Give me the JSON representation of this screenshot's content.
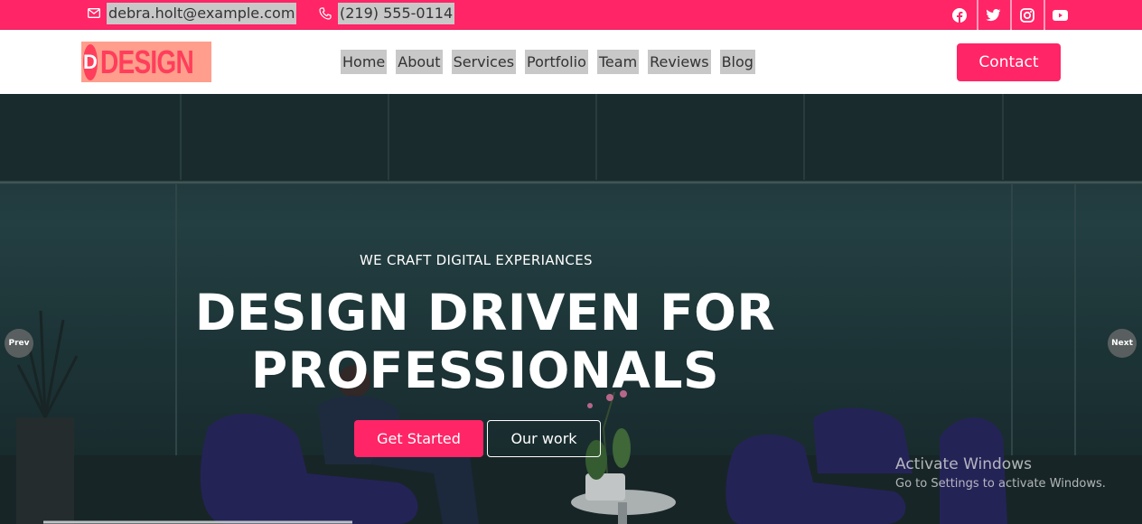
{
  "topbar": {
    "email": "debra.holt@example.com",
    "phone": "(219) 555-0114",
    "social": [
      "facebook-icon",
      "twitter-icon",
      "instagram-icon",
      "youtube-icon"
    ]
  },
  "header": {
    "logo_initial": "D",
    "logo_text": "DESIGN",
    "nav": [
      "Home",
      "About",
      "Services",
      "Portfolio",
      "Team",
      "Reviews",
      "Blog"
    ],
    "contact_label": "Contact"
  },
  "hero": {
    "eyebrow": "WE CRAFT DIGITAL EXPERIANCES",
    "headline_line1": "DESIGN DRIVEN FOR",
    "headline_line2": "PROFESSIONALS",
    "primary_button": "Get Started",
    "secondary_button": "Our work",
    "prev_label": "Prev",
    "next_label": "Next"
  },
  "watermark": {
    "title": "Activate Windows",
    "subtitle": "Go to Settings to activate Windows."
  },
  "colors": {
    "accent": "#ff2566",
    "logo_bg": "#ff9e8c",
    "logo_fg": "#ff3e5b"
  }
}
